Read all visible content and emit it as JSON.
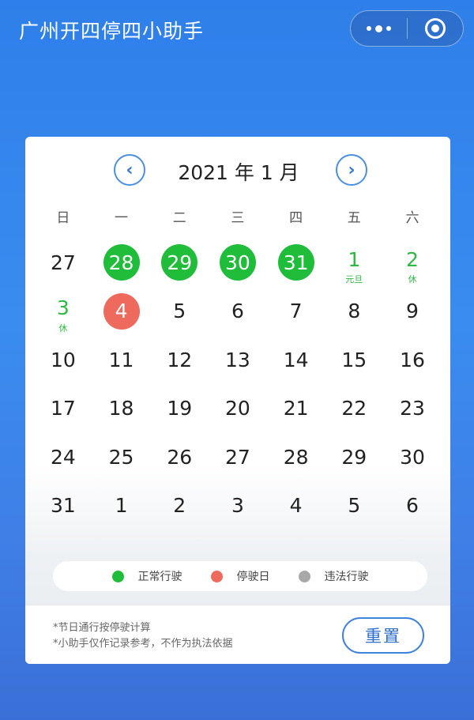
{
  "app": {
    "title": "广州开四停四小助手"
  },
  "capsule": {
    "more_icon": "more-dots-icon",
    "close_icon": "target-circle-icon"
  },
  "calendar": {
    "prev_label": "‹",
    "next_label": "›",
    "month_title": "2021 年 1 月",
    "weekdays": [
      "日",
      "一",
      "二",
      "三",
      "四",
      "五",
      "六"
    ],
    "weeks": [
      [
        {
          "d": "27"
        },
        {
          "d": "28",
          "t": "normal"
        },
        {
          "d": "29",
          "t": "normal"
        },
        {
          "d": "30",
          "t": "normal"
        },
        {
          "d": "31",
          "t": "normal"
        },
        {
          "d": "1",
          "t": "hol",
          "s": "元旦"
        },
        {
          "d": "2",
          "t": "hol",
          "s": "休"
        }
      ],
      [
        {
          "d": "3",
          "t": "hol",
          "s": "休"
        },
        {
          "d": "4",
          "t": "stop"
        },
        {
          "d": "5"
        },
        {
          "d": "6"
        },
        {
          "d": "7"
        },
        {
          "d": "8"
        },
        {
          "d": "9"
        }
      ],
      [
        {
          "d": "10"
        },
        {
          "d": "11"
        },
        {
          "d": "12"
        },
        {
          "d": "13"
        },
        {
          "d": "14"
        },
        {
          "d": "15"
        },
        {
          "d": "16"
        }
      ],
      [
        {
          "d": "17"
        },
        {
          "d": "18"
        },
        {
          "d": "19"
        },
        {
          "d": "20"
        },
        {
          "d": "21"
        },
        {
          "d": "22"
        },
        {
          "d": "23"
        }
      ],
      [
        {
          "d": "24"
        },
        {
          "d": "25"
        },
        {
          "d": "26"
        },
        {
          "d": "27"
        },
        {
          "d": "28"
        },
        {
          "d": "29"
        },
        {
          "d": "30"
        }
      ],
      [
        {
          "d": "31"
        },
        {
          "d": "1"
        },
        {
          "d": "2"
        },
        {
          "d": "3"
        },
        {
          "d": "4"
        },
        {
          "d": "5"
        },
        {
          "d": "6"
        }
      ]
    ]
  },
  "legend": [
    {
      "label": "正常行驶",
      "color": "#1fbd39"
    },
    {
      "label": "停驶日",
      "color": "#ee6a5c"
    },
    {
      "label": "违法行驶",
      "color": "#a8a8a8"
    }
  ],
  "footer": {
    "note1": "*节日通行按停驶计算",
    "note2": "*小助手仅作记录参考，不作为执法依据",
    "reset_label": "重置"
  }
}
